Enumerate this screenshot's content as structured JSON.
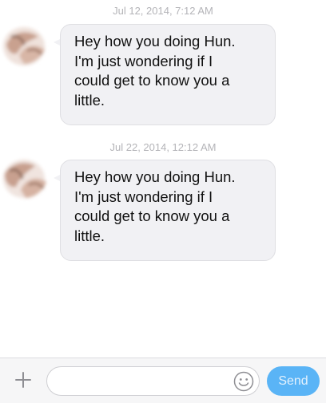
{
  "thread": {
    "messages": [
      {
        "timestamp": "Jul 12, 2014, 7:12 AM",
        "text": "Hey how you doing Hun.\nI'm just wondering if I\ncould get to know you a\nlittle."
      },
      {
        "timestamp": "Jul 22, 2014, 12:12 AM",
        "text": "Hey how you doing Hun.\nI'm just wondering if I\ncould get to know you a\nlittle."
      }
    ]
  },
  "composer": {
    "placeholder": "",
    "value": "",
    "send_label": "Send",
    "add_icon": "plus-icon",
    "emoji_icon": "smiley-icon"
  },
  "colors": {
    "bubble_bg": "#f1f1f4",
    "send_button_bg": "#5ab4f6",
    "timestamp_text": "#b4b4b8"
  }
}
